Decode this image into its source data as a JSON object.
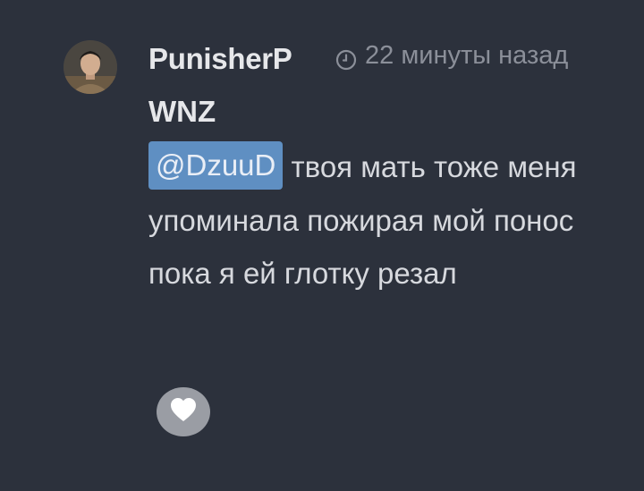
{
  "comment": {
    "author_line1": "PunisherP",
    "author_line2": "WNZ",
    "timestamp": "22 минуты назад",
    "mention": "@DzuuD",
    "text": " твоя мать тоже меня упоминала пожирая мой понос пока я ей глотку резал"
  },
  "icons": {
    "timestamp": "clock-icon",
    "like": "heart-icon"
  },
  "colors": {
    "background": "#2c313c",
    "mention_bg": "#5f8fc2",
    "timestamp": "#8b8f99",
    "like_button_bg": "#9a9da4"
  }
}
